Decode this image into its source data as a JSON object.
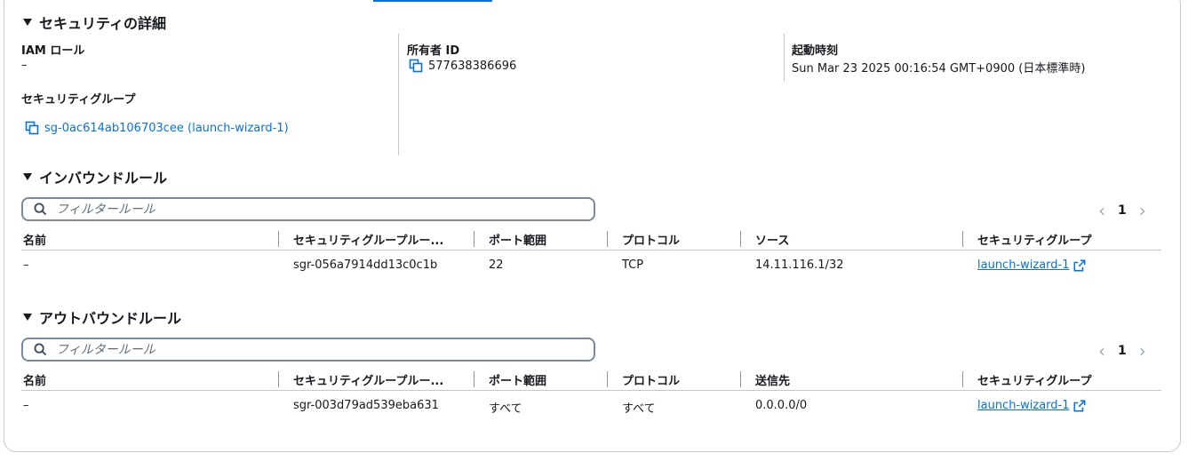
{
  "security_details": {
    "title": "セキュリティの詳細",
    "iam_role": {
      "label": "IAM ロール",
      "value": "–"
    },
    "owner_id": {
      "label": "所有者 ID",
      "value": "577638386696"
    },
    "launch_time": {
      "label": "起動時刻",
      "value": "Sun Mar 23 2025 00:16:54 GMT+0900 (日本標準時)"
    },
    "security_groups": {
      "label": "セキュリティグループ",
      "value": "sg-0ac614ab106703cee (launch-wizard-1)"
    }
  },
  "inbound": {
    "title": "インバウンドルール",
    "filter_placeholder": "フィルタールール",
    "page": "1",
    "columns": [
      "名前",
      "セキュリティグループルー...",
      "ポート範囲",
      "プロトコル",
      "ソース",
      "セキュリティグループ"
    ],
    "rows": [
      {
        "name": "–",
        "rule_id": "sgr-056a7914dd13c0c1b",
        "port": "22",
        "protocol": "TCP",
        "source": "14.11.116.1/32",
        "group": "launch-wizard-1"
      }
    ]
  },
  "outbound": {
    "title": "アウトバウンドルール",
    "filter_placeholder": "フィルタールール",
    "page": "1",
    "columns": [
      "名前",
      "セキュリティグループルー...",
      "ポート範囲",
      "プロトコル",
      "送信先",
      "セキュリティグループ"
    ],
    "rows": [
      {
        "name": "–",
        "rule_id": "sgr-003d79ad539eba631",
        "port": "すべて",
        "protocol": "すべて",
        "dest": "0.0.0.0/0",
        "group": "launch-wizard-1"
      }
    ]
  },
  "colors": {
    "link": "#0972d3",
    "border": "#c6c6cd",
    "text": "#16191f"
  }
}
